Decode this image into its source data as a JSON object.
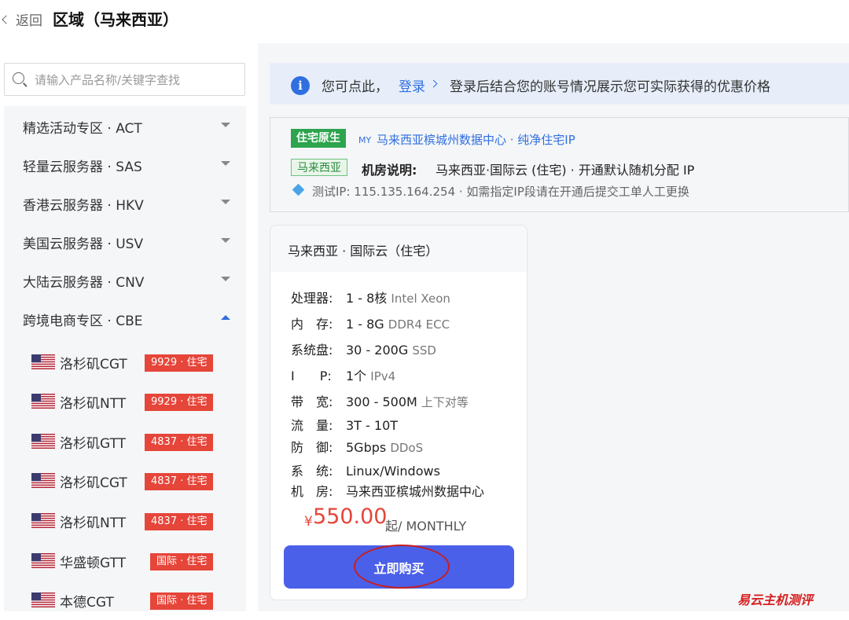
{
  "header": {
    "back_label": "返回",
    "title": "区域（马来西亚）"
  },
  "search": {
    "placeholder": "请输入产品名称/关键字查找"
  },
  "categories": [
    {
      "label": "精选活动专区 · ACT",
      "expanded": false
    },
    {
      "label": "轻量云服务器 · SAS",
      "expanded": false
    },
    {
      "label": "香港云服务器 · HKV",
      "expanded": false
    },
    {
      "label": "美国云服务器 · USV",
      "expanded": false
    },
    {
      "label": "大陆云服务器 · CNV",
      "expanded": false
    },
    {
      "label": "跨境电商专区 · CBE",
      "expanded": true
    }
  ],
  "sub_items": [
    {
      "label": "洛杉矶CGT",
      "tag": "9929 · 住宅",
      "icon": "us-flag-icon"
    },
    {
      "label": "洛杉矶NTT",
      "tag": "9929 · 住宅",
      "icon": "us-flag-icon"
    },
    {
      "label": "洛杉矶GTT",
      "tag": "4837 · 住宅",
      "icon": "us-flag-icon"
    },
    {
      "label": "洛杉矶CGT",
      "tag": "4837 · 住宅",
      "icon": "us-flag-icon"
    },
    {
      "label": "洛杉矶NTT",
      "tag": "4837 · 住宅",
      "icon": "us-flag-icon"
    },
    {
      "label": "华盛顿GTT",
      "tag": "国际 · 住宅",
      "icon": "us-flag-icon"
    },
    {
      "label": "本德CGT",
      "tag": "国际 · 住宅",
      "icon": "us-flag-icon"
    }
  ],
  "notice": {
    "text_prefix": "您可点此，",
    "login_link": "登录",
    "text_suffix": "登录后结合您的账号情况展示您可实际获得的优惠价格"
  },
  "datacenter": {
    "badge": "住宅原生",
    "country_code": "MY",
    "name": "马来西亚槟城州数据中心 · 纯净住宅IP",
    "country_badge": "马来西亚",
    "room_label": "机房说明:",
    "room_desc": "马来西亚·国际云 (住宅) · 开通默认随机分配 IP",
    "test_ip": "测试IP: 115.135.164.254 · 如需指定IP段请在开通后提交工单人工更换"
  },
  "plan": {
    "title": "马来西亚 · 国际云（住宅）",
    "specs": [
      {
        "key": "处理器:",
        "value": "1 - 8核",
        "extra": "Intel Xeon"
      },
      {
        "key": "内　存:",
        "value": "1 - 8G",
        "extra": "DDR4 ECC"
      },
      {
        "key": "系统盘:",
        "value": "30 - 200G",
        "extra": "SSD"
      },
      {
        "key": "I　　P:",
        "value": "1个",
        "extra": "IPv4"
      },
      {
        "key": "带　宽:",
        "value": "300 - 500M",
        "extra": "上下对等"
      },
      {
        "key": "流　量:",
        "value": "3T - 10T",
        "extra": ""
      },
      {
        "key": "防　御:",
        "value": "5Gbps",
        "extra": "DDoS"
      },
      {
        "key": "系　统:",
        "value": "Linux/Windows",
        "extra": ""
      },
      {
        "key": "机　房:",
        "value": "马来西亚槟城州数据中心",
        "extra": ""
      }
    ],
    "currency": "¥",
    "price": "550.00",
    "price_unit": "起/ MONTHLY",
    "buy_label": "立即购买"
  },
  "watermark": "易云主机测评",
  "colors": {
    "accent": "#2f6fe0",
    "tag_red": "#e6453a",
    "buy_button": "#4b60e8",
    "badge_green": "#2da44e"
  }
}
